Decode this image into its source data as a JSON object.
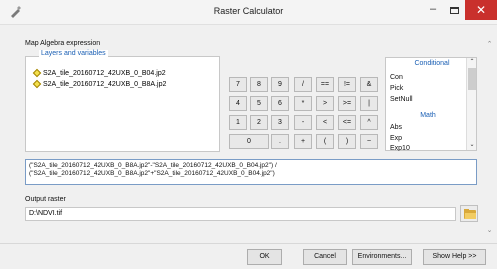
{
  "window": {
    "title": "Raster Calculator",
    "minimize_glyph": "–",
    "close_glyph": "✕"
  },
  "map_algebra": {
    "label": "Map Algebra expression",
    "layers_title": "Layers and variables",
    "layers": [
      "S2A_tile_20160712_42UXB_0_B04.jp2",
      "S2A_tile_20160712_42UXB_0_B8A.jp2"
    ]
  },
  "keypad": {
    "row1": [
      "7",
      "8",
      "9",
      "/",
      "==",
      "!=",
      "&"
    ],
    "row2": [
      "4",
      "5",
      "6",
      "*",
      ">",
      ">=",
      "|"
    ],
    "row3": [
      "1",
      "2",
      "3",
      "-",
      "<",
      "<=",
      "^"
    ],
    "row4": [
      "0",
      ".",
      "+",
      "(",
      ")",
      "~"
    ]
  },
  "functions": {
    "conditional_header": "Conditional",
    "conditional": [
      "Con",
      "Pick",
      "SetNull"
    ],
    "math_header": "Math",
    "math": [
      "Abs",
      "Exp",
      "Exp10"
    ]
  },
  "expression": {
    "line1": "(\"S2A_tile_20160712_42UXB_0_B8A.jp2\"-\"S2A_tile_20160712_42UXB_0_B04.jp2\") /",
    "line2": "(\"S2A_tile_20160712_42UXB_0_B8A.jp2\"+\"S2A_tile_20160712_42UXB_0_B04.jp2\")"
  },
  "output": {
    "label": "Output raster",
    "value": "D:\\NDVI.tif"
  },
  "buttons": {
    "ok": "OK",
    "cancel": "Cancel",
    "environments": "Environments...",
    "show_help": "Show Help >>"
  },
  "scroll_glyphs": {
    "up": "⌃",
    "down": "⌄"
  },
  "colors": {
    "accent": "#1a5fb4",
    "close_button": "#c9302c",
    "layer_icon": "#f4e04d"
  }
}
